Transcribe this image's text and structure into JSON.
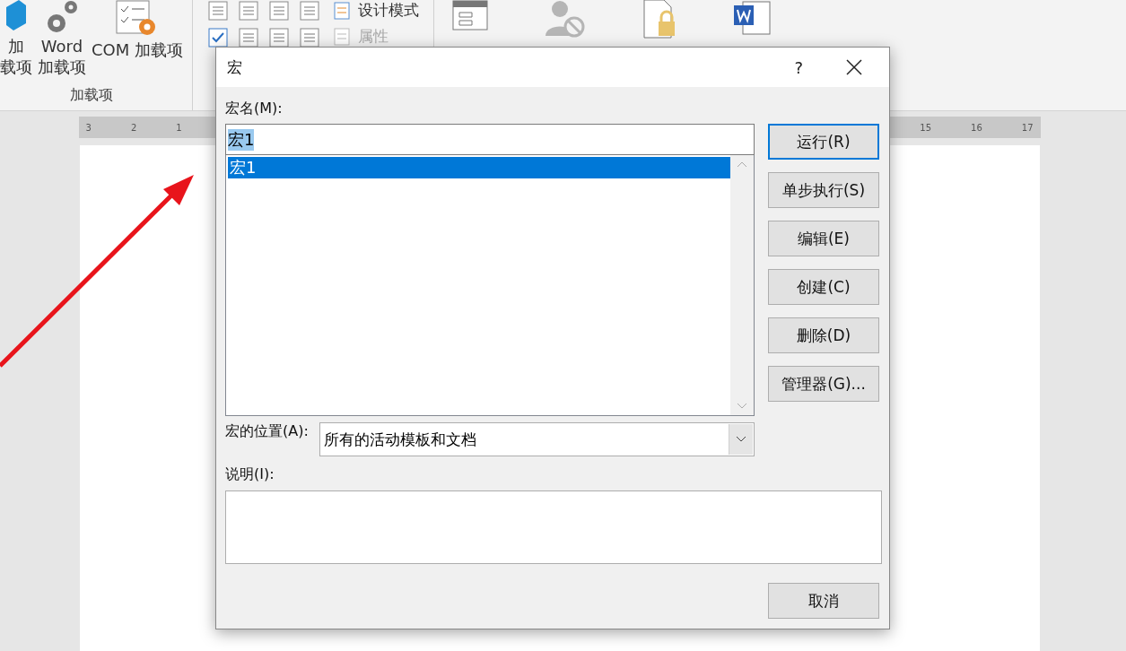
{
  "ribbon": {
    "addins_group": {
      "buttons": [
        {
          "kind": "cube",
          "lines": [
            "加",
            "载项"
          ]
        },
        {
          "kind": "gears",
          "lines": [
            "Word",
            "加载项"
          ]
        },
        {
          "kind": "checklist",
          "lines": [
            "COM 加载项"
          ]
        }
      ],
      "title": "加载项"
    },
    "controls_group": {
      "items": [
        {
          "label": "设计模式",
          "disabled": false
        },
        {
          "label": "属性",
          "disabled": true
        }
      ]
    }
  },
  "ruler": {
    "left_numbers": [
      "3",
      "2",
      "1"
    ],
    "right_numbers": [
      "15",
      "16",
      "17"
    ]
  },
  "dialog": {
    "title": "宏",
    "help": "?",
    "name_label": {
      "text": "宏名(M):"
    },
    "name_field": {
      "value": "宏1",
      "value_selected": true
    },
    "macros": [
      {
        "label": "宏1",
        "selected": true
      }
    ],
    "buttons": [
      {
        "label": "运行(R)",
        "default": true
      },
      {
        "label": "单步执行(S)",
        "default": false
      },
      {
        "label": "编辑(E)",
        "default": false
      },
      {
        "label": "创建(C)",
        "default": false
      },
      {
        "label": "删除(D)",
        "default": false
      },
      {
        "label": "管理器(G)...",
        "default": false
      }
    ],
    "location_label": {
      "text": "宏的位置(A):"
    },
    "location_value": "所有的活动模板和文档",
    "description_label": {
      "text": "说明(I):"
    },
    "cancel": "取消"
  }
}
